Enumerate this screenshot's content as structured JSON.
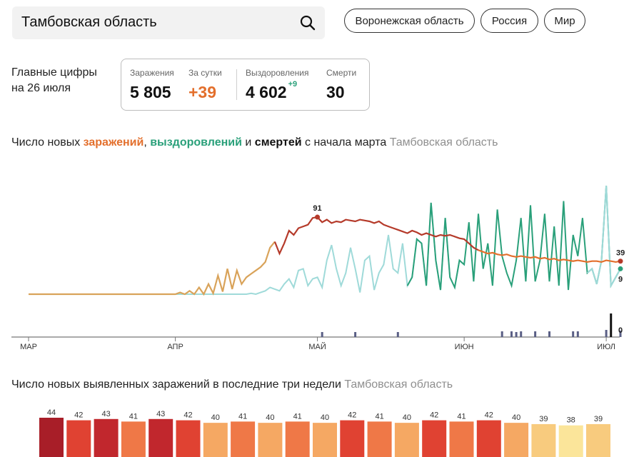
{
  "search": {
    "value": "Тамбовская область"
  },
  "regions": [
    "Воронежская область",
    "Россия",
    "Мир"
  ],
  "summary": {
    "title_line1": "Главные цифры",
    "title_line2": "на 26 июля",
    "infections_label": "Заражения",
    "infections_value": "5 805",
    "daily_label": "За сутки",
    "daily_value": "+39",
    "recoveries_label": "Выздоровления",
    "recoveries_value": "4 602",
    "recoveries_delta": "+9",
    "deaths_label": "Смерти",
    "deaths_value": "30"
  },
  "colors": {
    "infections_early": "#d9a35a",
    "infections": "#b53a2a",
    "recoveries": "#2aa07a",
    "recoveries_light": "#9fdad9",
    "deaths": "#5a5f85",
    "deaths_last": "#111111",
    "accent_orange": "#e36f2c"
  },
  "chart1_heading": {
    "p1": "Число новых ",
    "infections": "заражений",
    "p2": ", ",
    "recoveries": "выздоровлений",
    "p3": " и ",
    "deaths": "смертей",
    "p4": " с начала марта",
    "region": "Тамбовская область"
  },
  "chart2_heading": {
    "text": "Число новых выявленных заражений в последние три недели",
    "region": "Тамбовская область"
  },
  "chart_data": [
    {
      "type": "line",
      "x_labels": [
        "МАР",
        "АПР",
        "МАЙ",
        "ИЮН",
        "ИЮЛ"
      ],
      "series": [
        {
          "key": "infections",
          "values": [
            0,
            0,
            0,
            0,
            0,
            0,
            0,
            0,
            0,
            0,
            0,
            0,
            0,
            0,
            0,
            0,
            0,
            0,
            0,
            0,
            0,
            0,
            0,
            0,
            0,
            0,
            0,
            0,
            0,
            0,
            0,
            0,
            2,
            0,
            4,
            0,
            8,
            0,
            12,
            1,
            22,
            3,
            30,
            6,
            28,
            12,
            20,
            24,
            28,
            32,
            38,
            55,
            62,
            48,
            60,
            75,
            70,
            78,
            80,
            82,
            90,
            91,
            85,
            88,
            84,
            86,
            85,
            88,
            87,
            86,
            88,
            87,
            86,
            84,
            86,
            82,
            80,
            78,
            76,
            74,
            72,
            75,
            73,
            70,
            72,
            70,
            68,
            70,
            69,
            70,
            68,
            66,
            65,
            60,
            55,
            52,
            50,
            48,
            49,
            47,
            46,
            47,
            45,
            44,
            45,
            44,
            43,
            44,
            42,
            43,
            41,
            42,
            40,
            41,
            40,
            39,
            40,
            39,
            38,
            39,
            39,
            38,
            40,
            39,
            38,
            39
          ],
          "label_peak": "91",
          "label_last": "39"
        },
        {
          "key": "recoveries",
          "values": [
            0,
            0,
            0,
            0,
            0,
            0,
            0,
            0,
            0,
            0,
            0,
            0,
            0,
            0,
            0,
            0,
            0,
            0,
            0,
            0,
            0,
            0,
            0,
            0,
            0,
            0,
            0,
            0,
            0,
            0,
            0,
            0,
            0,
            0,
            0,
            0,
            0,
            0,
            0,
            0,
            0,
            0,
            0,
            0,
            0,
            0,
            0,
            1,
            0,
            2,
            4,
            8,
            6,
            4,
            12,
            18,
            8,
            28,
            30,
            10,
            18,
            20,
            8,
            40,
            58,
            30,
            10,
            25,
            55,
            30,
            2,
            40,
            45,
            5,
            25,
            35,
            70,
            30,
            25,
            60,
            10,
            20,
            65,
            60,
            10,
            108,
            40,
            5,
            90,
            20,
            8,
            40,
            35,
            85,
            15,
            95,
            30,
            60,
            10,
            100,
            45,
            25,
            10,
            40,
            90,
            15,
            105,
            15,
            40,
            95,
            15,
            80,
            10,
            110,
            5,
            70,
            45,
            90,
            25,
            30,
            12,
            40,
            128,
            10,
            20,
            30,
            3,
            9
          ],
          "label_last": "9"
        },
        {
          "key": "deaths",
          "values": [
            0,
            0,
            0,
            0,
            0,
            0,
            0,
            0,
            0,
            0,
            0,
            0,
            0,
            0,
            0,
            0,
            0,
            0,
            0,
            0,
            0,
            0,
            0,
            0,
            0,
            0,
            0,
            0,
            0,
            0,
            0,
            0,
            0,
            0,
            0,
            0,
            0,
            0,
            0,
            0,
            0,
            0,
            0,
            0,
            0,
            0,
            0,
            0,
            0,
            0,
            0,
            0,
            0,
            0,
            0,
            0,
            0,
            0,
            0,
            0,
            0,
            0,
            1,
            0,
            0,
            0,
            0,
            0,
            0,
            1,
            0,
            0,
            0,
            0,
            0,
            0,
            0,
            0,
            1,
            0,
            0,
            0,
            0,
            0,
            0,
            0,
            0,
            0,
            0,
            0,
            0,
            0,
            0,
            0,
            0,
            0,
            0,
            0,
            0,
            0,
            0,
            0,
            0,
            1,
            0,
            0,
            0,
            0,
            0,
            0,
            0,
            0,
            0,
            0,
            0,
            0,
            0,
            0,
            0,
            0,
            0,
            0,
            0,
            0,
            0,
            0,
            0,
            0
          ],
          "label_last": "0"
        }
      ]
    },
    {
      "type": "bar",
      "values": [
        44,
        42,
        43,
        41,
        43,
        42,
        40,
        41,
        40,
        41,
        40,
        42,
        41,
        40,
        42,
        41,
        42,
        40,
        39,
        38,
        39
      ],
      "colors": [
        "#a81e28",
        "#e04232",
        "#c1272d",
        "#ef7847",
        "#c1272d",
        "#e04232",
        "#f5a863",
        "#ef7847",
        "#f5a863",
        "#ef7847",
        "#f5a863",
        "#e04232",
        "#ef7847",
        "#f5a863",
        "#e04232",
        "#ef7847",
        "#e04232",
        "#f5a863",
        "#f8cb7e",
        "#fbe59a",
        "#f8cb7e"
      ]
    }
  ]
}
